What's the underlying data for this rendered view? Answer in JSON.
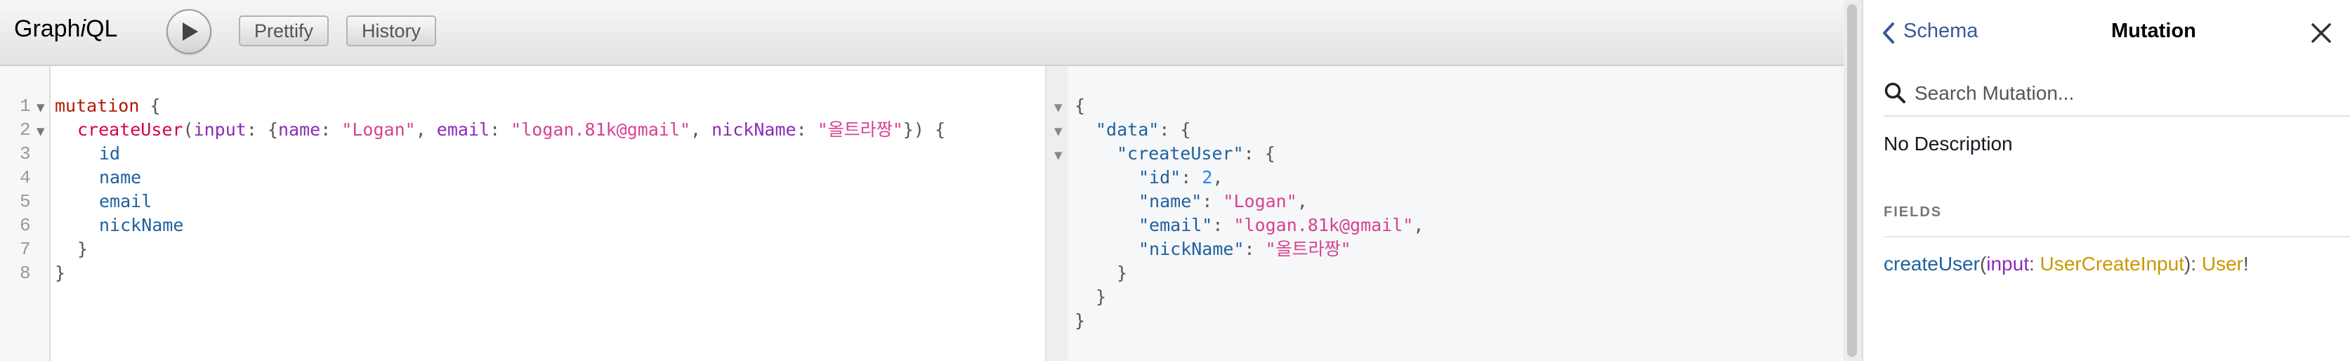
{
  "toolbar": {
    "logo_prefix": "Graph",
    "logo_italic": "i",
    "logo_suffix": "QL",
    "prettify_label": "Prettify",
    "history_label": "History"
  },
  "query_editor": {
    "line_numbers": [
      "1",
      "2",
      "3",
      "4",
      "5",
      "6",
      "7",
      "8"
    ],
    "lines": {
      "l1": {
        "kw": "mutation",
        "rest": " {"
      },
      "l2": {
        "field": "createUser",
        "p1": "(",
        "arg": "input",
        "p2": ": {",
        "k1": "name",
        "c1": ": ",
        "v1": "\"Logan\"",
        "s1": ", ",
        "k2": "email",
        "c2": ": ",
        "v2": "\"logan.81k@gmail\"",
        "s2": ", ",
        "k3": "nickName",
        "c3": ": ",
        "v3": "\"올트라짱\"",
        "end": "}) {"
      },
      "l3": "id",
      "l4": "name",
      "l5": "email",
      "l6": "nickName",
      "l7": "}",
      "l8": "}"
    }
  },
  "result": {
    "open": "{",
    "data_key": "\"data\"",
    "create_user_key": "\"createUser\"",
    "id_key": "\"id\"",
    "id_value": "2",
    "name_key": "\"name\"",
    "name_value": "\"Logan\"",
    "email_key": "\"email\"",
    "email_value": "\"logan.81k@gmail\"",
    "nick_key": "\"nickName\"",
    "nick_value": "\"올트라짱\"",
    "close": "}"
  },
  "docs": {
    "back_label": "Schema",
    "title": "Mutation",
    "search_placeholder": "Search Mutation...",
    "description": "No Description",
    "fields_heading": "FIELDS",
    "field": {
      "name": "createUser",
      "open": "(",
      "arg": "input",
      "colon": ": ",
      "arg_type": "UserCreateInput",
      "close": "): ",
      "return_type": "User",
      "bang": "!"
    }
  },
  "colors": {
    "keyword": "#b11a04",
    "property": "#1f61a0",
    "argument": "#8b2bb9",
    "string": "#d64292",
    "number": "#2882f9",
    "type": "#ca9800",
    "link": "#3b5998"
  },
  "icons": [
    "play-icon",
    "chevron-left-icon",
    "close-icon",
    "search-icon",
    "fold-arrow-icon"
  ]
}
